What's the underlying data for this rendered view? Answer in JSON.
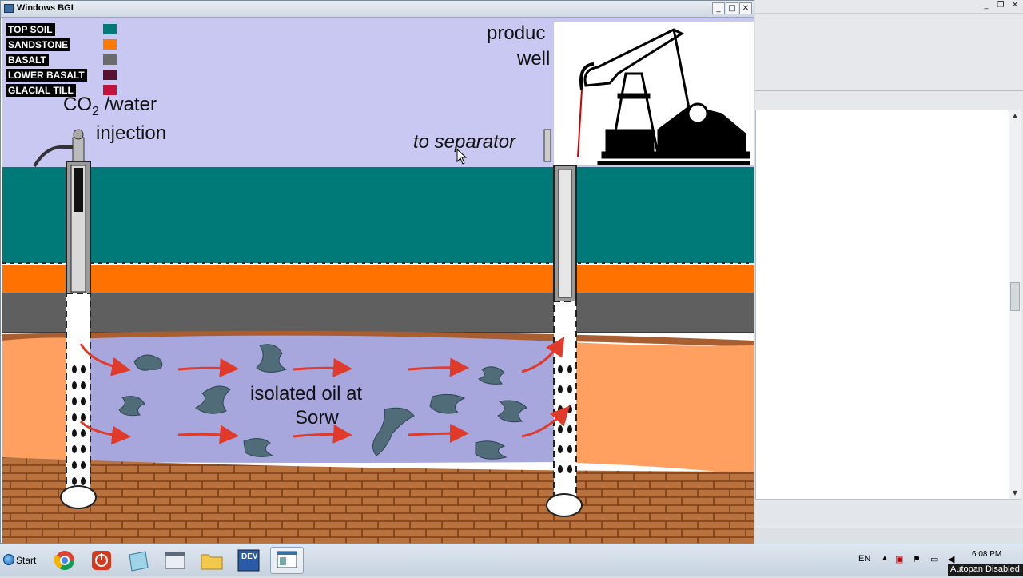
{
  "window": {
    "title": "Windows BGI",
    "min_glyph": "_",
    "max_glyph": "□",
    "close_glyph": "✕"
  },
  "legend": [
    {
      "label": "TOP SOIL",
      "color": "#007a78"
    },
    {
      "label": "SANDSTONE",
      "color": "#ff7a00"
    },
    {
      "label": "BASALT",
      "color": "#6b6b6b"
    },
    {
      "label": "LOWER BASALT",
      "color": "#5a1030"
    },
    {
      "label": "GLACIAL TILL",
      "color": "#c0143c"
    }
  ],
  "labels": {
    "co2_main": "CO",
    "co2_sub": "2",
    "co2_rest": " /water",
    "injection": "injection",
    "producing_line1": "produc",
    "producing_line2": "well",
    "to_separator": "to separator",
    "oil_line1": "isolated oil at",
    "oil_line2": "Sorw"
  },
  "right_pane": {
    "min_glyph": "_",
    "restore_glyph": "❐",
    "close_glyph": "✕"
  },
  "taskbar": {
    "start_label": "Start",
    "apps": [
      "chrome-icon",
      "power-icon",
      "notes-icon",
      "window-icon",
      "folder-icon",
      "dev-icon",
      "bgi-app-icon"
    ],
    "dev_label": "DEV",
    "language": "EN",
    "time": "6:08 PM",
    "status_text": "Autopan Disabled"
  },
  "colors": {
    "sky": "#c9c8f2",
    "top_soil": "#007a78",
    "sandstone": "#ff7a00",
    "basalt": "#636363",
    "reservoir_orange": "#ffa060",
    "reservoir_purple": "#a8a8de",
    "brick": "#b8703c",
    "arrow": "#e03a2a",
    "oil": "#4f6c78"
  }
}
